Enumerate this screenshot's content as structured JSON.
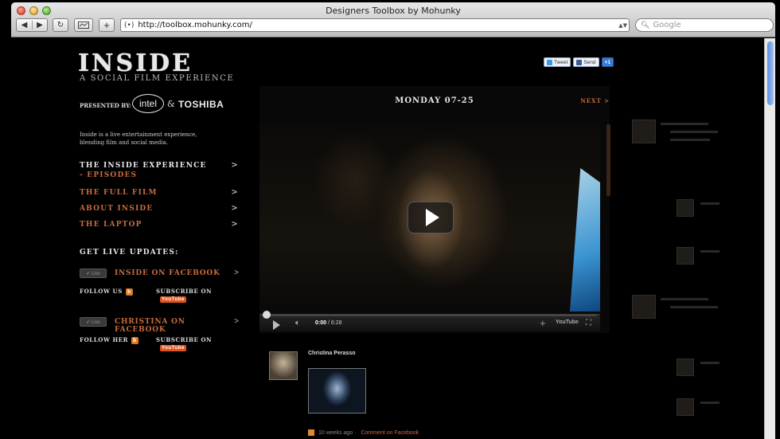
{
  "browser": {
    "window_title": "Designers Toolbox by Mohunky",
    "url": "http://toolbox.mohunky.com/",
    "search_placeholder": "Google",
    "nav_back": "◀",
    "nav_forward": "▶",
    "reload": "↻",
    "add": "+"
  },
  "site": {
    "logo": "INSIDE",
    "tagline": "A SOCIAL FILM EXPERIENCE",
    "presented_by": "PRESENTED BY:",
    "sponsor1": "intel",
    "sponsor_amp": "&",
    "sponsor2": "TOSHIBA",
    "intro": "Inside is a live entertainment experience, blending film and social media."
  },
  "menu": {
    "items": [
      {
        "label": "THE INSIDE EXPERIENCE",
        "sub": "- EPISODES"
      },
      {
        "label": "THE FULL FILM"
      },
      {
        "label": "ABOUT INSIDE"
      },
      {
        "label": "THE LAPTOP"
      }
    ],
    "arrow": ">"
  },
  "updates": {
    "heading": "GET LIVE UPDATES:",
    "like_label": "✔ Like",
    "inside_fb": "INSIDE ON FACEBOOK",
    "christina_fb": "CHRISTINA ON FACEBOOK",
    "follow_us": "FOLLOW US",
    "follow_her": "FOLLOW HER",
    "subscribe_on": "SUBSCRIBE ON",
    "youtube": "YouTube",
    "blogger": "b"
  },
  "social": {
    "tweet": "Tweet",
    "send": "Send",
    "plus1": "+1"
  },
  "video": {
    "day_title": "MONDAY 07-25",
    "next": "NEXT >",
    "time_current": "0:00",
    "time_total": "/ 6:28",
    "progress_fraction": 0.0,
    "youtube_logo": "YouTube"
  },
  "post": {
    "author": "Christina Perasso",
    "age": "10 weeks ago",
    "separator": "·",
    "comment_link": "Comment on Facebook"
  },
  "colors": {
    "accent_orange": "#c86a3c",
    "background": "#000000"
  }
}
